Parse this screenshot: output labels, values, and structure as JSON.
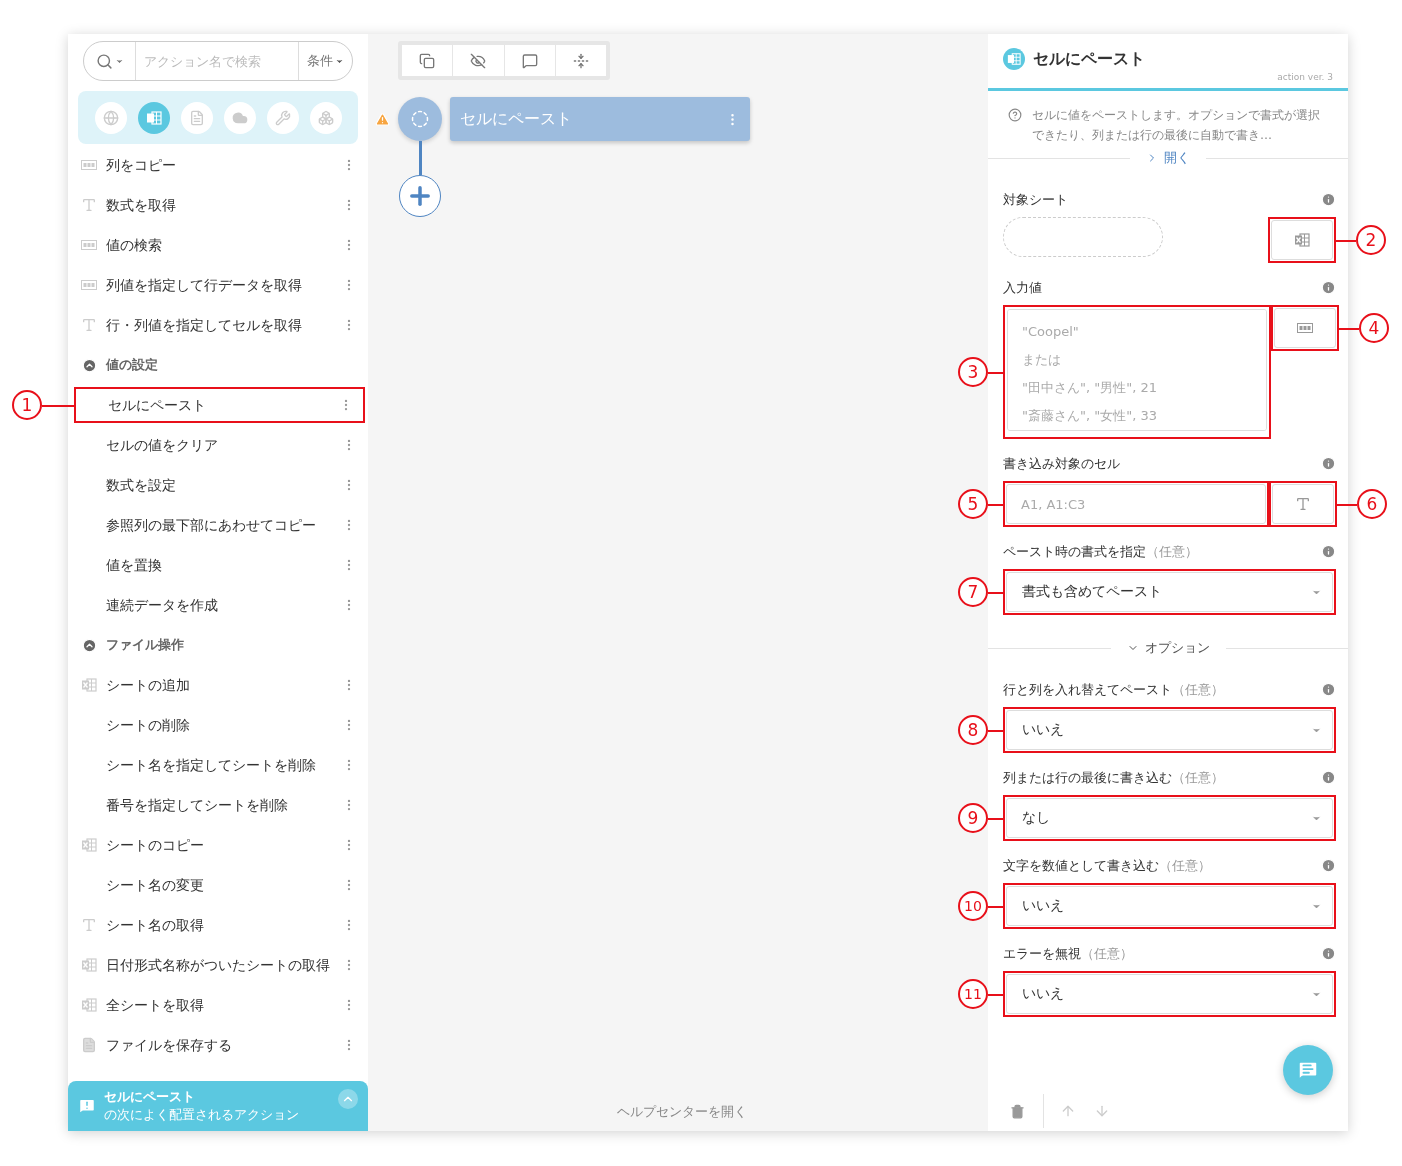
{
  "sidebar": {
    "search": {
      "placeholder": "アクション名で検索",
      "filter_label": "条件"
    },
    "categories": [
      {
        "kind": "web",
        "selected": false
      },
      {
        "kind": "excel",
        "selected": true
      },
      {
        "kind": "document",
        "selected": false
      },
      {
        "kind": "cloud",
        "selected": false
      },
      {
        "kind": "tools",
        "selected": false
      },
      {
        "kind": "packages",
        "selected": false
      }
    ],
    "items": [
      {
        "kind": "column",
        "label": "列をコピー"
      },
      {
        "kind": "text",
        "label": "数式を取得"
      },
      {
        "kind": "column",
        "label": "値の検索"
      },
      {
        "kind": "column",
        "label": "列値を指定して行データを取得"
      },
      {
        "kind": "text",
        "label": "行・列値を指定してセルを取得"
      },
      {
        "kind": "section",
        "label": "値の設定",
        "expanded": true
      },
      {
        "kind": "plain",
        "label": "セルにペースト",
        "callout": "1"
      },
      {
        "kind": "plain",
        "label": "セルの値をクリア"
      },
      {
        "kind": "plain",
        "label": "数式を設定"
      },
      {
        "kind": "plain",
        "label": "参照列の最下部にあわせてコピー"
      },
      {
        "kind": "plain",
        "label": "値を置換"
      },
      {
        "kind": "plain",
        "label": "連続データを作成"
      },
      {
        "kind": "section",
        "label": "ファイル操作",
        "expanded": true
      },
      {
        "kind": "sheet",
        "label": "シートの追加"
      },
      {
        "kind": "plain",
        "label": "シートの削除"
      },
      {
        "kind": "plain",
        "label": "シート名を指定してシートを削除"
      },
      {
        "kind": "plain",
        "label": "番号を指定してシートを削除"
      },
      {
        "kind": "sheet",
        "label": "シートのコピー"
      },
      {
        "kind": "plain",
        "label": "シート名の変更"
      },
      {
        "kind": "text",
        "label": "シート名の取得"
      },
      {
        "kind": "sheet",
        "label": "日付形式名称がついたシートの取得"
      },
      {
        "kind": "sheet",
        "label": "全シートを取得"
      },
      {
        "kind": "file",
        "label": "ファイルを保存する"
      }
    ],
    "suggestion": {
      "title": "セルにペースト",
      "subtitle": "の次によく配置されるアクション"
    }
  },
  "canvas": {
    "node": {
      "label": "セルにペースト",
      "warning": true
    },
    "help_link": "ヘルプセンターを開く"
  },
  "panel": {
    "title": "セルにペースト",
    "version": "action ver. 3",
    "description": "セルに値をペーストします。オプションで書式が選択できたり、列または行の最後に自動で書き…",
    "expand_link": "開く",
    "fields": [
      {
        "kind": "sheet",
        "label": "対象シート",
        "button_callout": "2"
      },
      {
        "kind": "textarea",
        "label": "入力値",
        "placeholder": "\"Coopel\"\nまたは\n\"田中さん\", \"男性\", 21\n\"斎藤さん\", \"女性\", 33",
        "callout": "3",
        "button_callout": "4"
      },
      {
        "kind": "text",
        "label": "書き込み対象のセル",
        "placeholder": "A1, A1:C3",
        "callout": "5",
        "button_callout": "6"
      },
      {
        "kind": "select",
        "label": "ペースト時の書式を指定",
        "optional": "（任意）",
        "value": "書式も含めてペースト",
        "callout": "7"
      }
    ],
    "options": {
      "label": "オプション",
      "expanded": true,
      "fields": [
        {
          "kind": "select",
          "label": "行と列を入れ替えてペースト",
          "optional": "（任意）",
          "value": "いいえ",
          "callout": "8"
        },
        {
          "kind": "select",
          "label": "列または行の最後に書き込む",
          "optional": "（任意）",
          "value": "なし",
          "callout": "9"
        },
        {
          "kind": "select",
          "label": "文字を数値として書き込む",
          "optional": "（任意）",
          "value": "いいえ",
          "callout": "10"
        },
        {
          "kind": "select",
          "label": "エラーを無視",
          "optional": "（任意）",
          "value": "いいえ",
          "callout": "11"
        }
      ]
    }
  }
}
